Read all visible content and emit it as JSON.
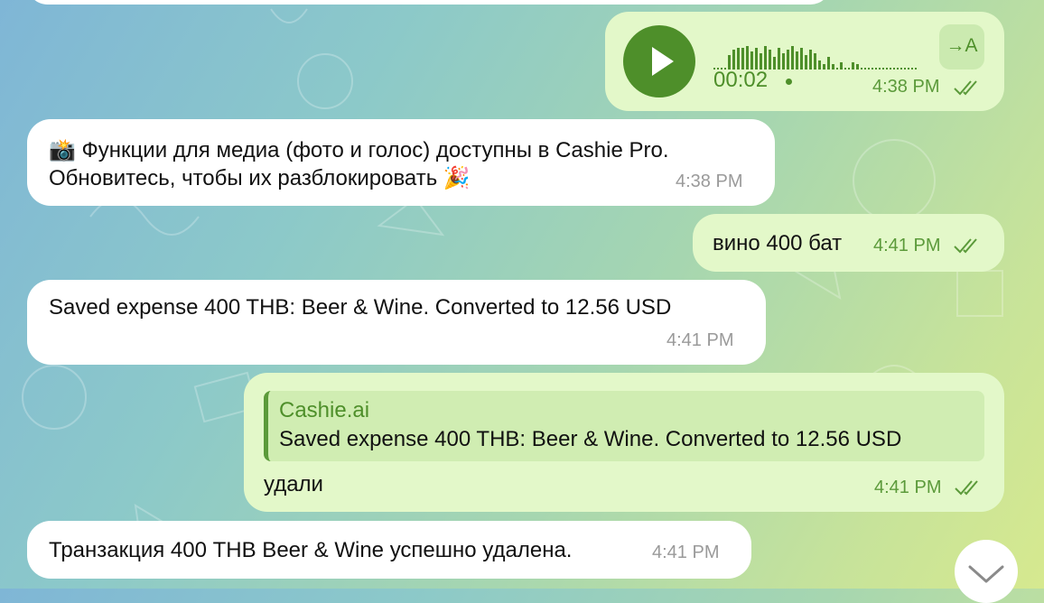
{
  "messages": {
    "voice": {
      "duration": "00:02",
      "time": "4:38 PM",
      "transcribe_label": "→A"
    },
    "m1": {
      "text_line1": "📸 Функции для медиа (фото и голос) доступны в Cashie Pro.",
      "text_line2": "Обновитесь, чтобы их разблокировать 🎉",
      "time": "4:38 PM"
    },
    "m2": {
      "text": "вино 400 бат",
      "time": "4:41 PM"
    },
    "m3": {
      "text": "Saved expense 400 THB: Beer & Wine. Converted to 12.56 USD",
      "time": "4:41 PM"
    },
    "m4": {
      "reply_author": "Cashie.ai",
      "reply_text": "Saved expense 400 THB: Beer & Wine. Converted to 12.56 USD",
      "text": "удали",
      "time": "4:41 PM"
    },
    "m5": {
      "text": "Транзакция 400 THB Beer & Wine успешно удалена.",
      "time": "4:41 PM"
    }
  },
  "icons": [
    "play-icon",
    "transcribe-icon",
    "read-ticks-icon",
    "scroll-down-icon"
  ],
  "colors": {
    "outgoing_bubble": "#e3f8c9",
    "incoming_bubble": "#ffffff",
    "accent_green": "#4e8f2a",
    "time_green": "#5b9a3a"
  }
}
